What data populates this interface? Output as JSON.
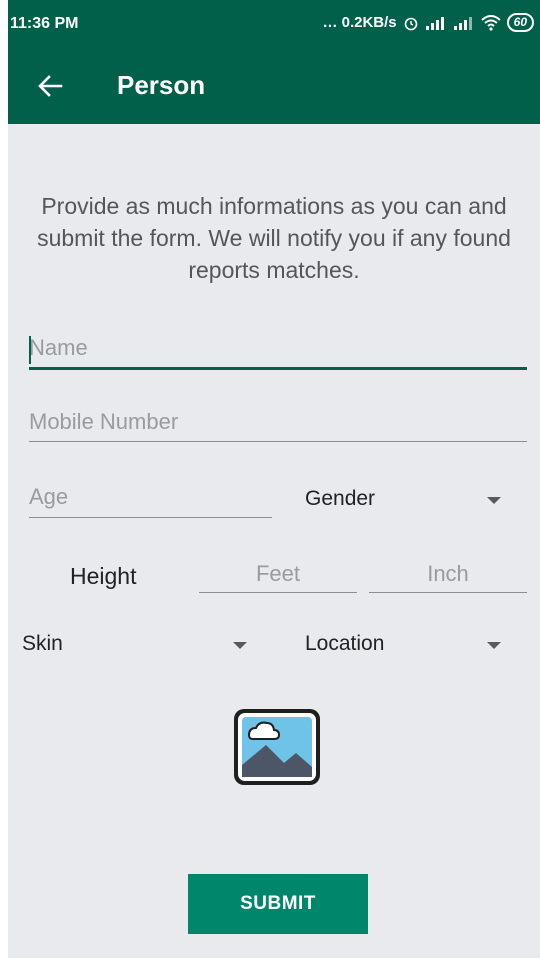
{
  "status_bar": {
    "time": "11:36 PM",
    "network_speed": "… 0.2KB/s",
    "battery": "60"
  },
  "toolbar": {
    "title": "Person",
    "back_icon": "arrow-left-icon",
    "background": "#00604a"
  },
  "intro_text": "Provide as much informations as you can and submit the form. We will notify you if any found reports matches.",
  "form": {
    "name_placeholder": "Name",
    "mobile_placeholder": "Mobile Number",
    "age_placeholder": "Age",
    "gender_label": "Gender",
    "height_label": "Height",
    "feet_placeholder": "Feet",
    "inch_placeholder": "Inch",
    "skin_label": "Skin",
    "location_label": "Location",
    "image_icon": "image-placeholder-icon"
  },
  "submit_label": "SUBMIT",
  "colors": {
    "primary": "#00604a",
    "button": "#00876b",
    "background": "#e9eaed"
  }
}
